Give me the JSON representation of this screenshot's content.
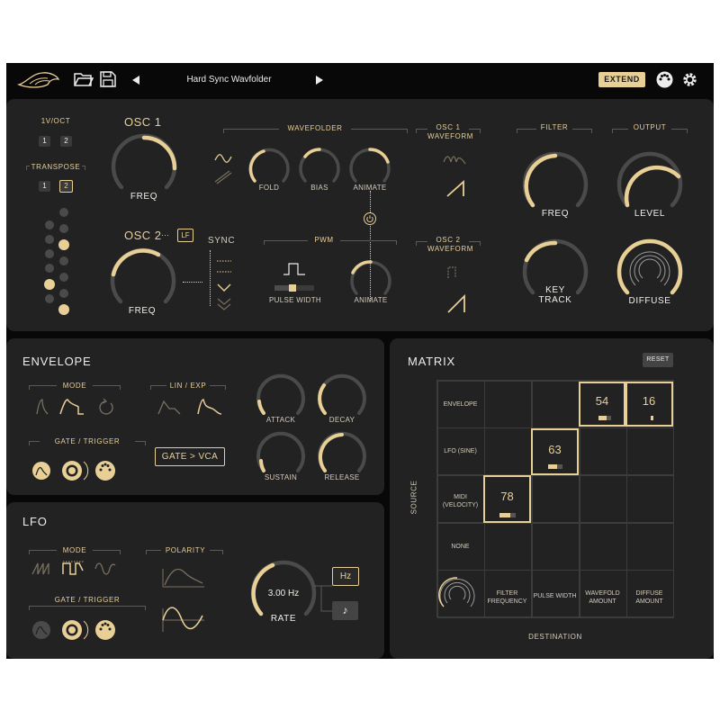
{
  "header": {
    "preset_name": "Hard Sync Wavfolder",
    "extend_label": "EXTEND"
  },
  "osc_section": {
    "vroct_label": "1V/OCT",
    "vroct_buttons": [
      "1",
      "2"
    ],
    "transpose_label": "TRANSPOSE",
    "transpose_buttons": [
      "1",
      "2"
    ],
    "osc1_title": "OSC 1",
    "osc1_freq_label": "FREQ",
    "osc2_title": "OSC 2",
    "osc2_badge": "LF",
    "osc2_freq_label": "FREQ",
    "sync_label": "SYNC",
    "wavefolder_label": "WAVEFOLDER",
    "fold_label": "FOLD",
    "bias_label": "BIAS",
    "wf_animate_label": "ANIMATE",
    "pwm_label": "PWM",
    "pulse_width_label": "PULSE WIDTH",
    "pwm_animate_label": "ANIMATE",
    "osc1_waveform_label_1": "OSC 1",
    "osc1_waveform_label_2": "WAVEFORM",
    "osc2_waveform_label_1": "OSC 2",
    "osc2_waveform_label_2": "WAVEFORM",
    "filter_label": "FILTER",
    "filter_freq_label": "FREQ",
    "key_track_label_1": "KEY",
    "key_track_label_2": "TRACK",
    "output_label": "OUTPUT",
    "level_label": "LEVEL",
    "diffuse_label": "DIFFUSE"
  },
  "envelope": {
    "title": "ENVELOPE",
    "mode_label": "MODE",
    "lin_exp_label": "LIN / EXP",
    "gate_trigger_label": "GATE / TRIGGER",
    "gate_vca_label": "GATE > VCA",
    "attack_label": "ATTACK",
    "decay_label": "DECAY",
    "sustain_label": "SUSTAIN",
    "release_label": "RELEASE"
  },
  "lfo": {
    "title": "LFO",
    "mode_label": "MODE",
    "polarity_label": "POLARITY",
    "gate_trigger_label": "GATE / TRIGGER",
    "rate_value": "3.00 Hz",
    "rate_label": "RATE",
    "hz_label": "Hz",
    "note_icon": "♪"
  },
  "matrix": {
    "title": "MATRIX",
    "reset_label": "RESET",
    "source_axis": "SOURCE",
    "destination_axis": "DESTINATION",
    "rows": [
      {
        "label_1": "ENVELOPE",
        "label_2": ""
      },
      {
        "label_1": "LFO (SINE)",
        "label_2": ""
      },
      {
        "label_1": "MIDI",
        "label_2": "(VELOCITY)"
      },
      {
        "label_1": "NONE",
        "label_2": ""
      }
    ],
    "columns": [
      {
        "label_1": "FILTER",
        "label_2": "FREQUENCY"
      },
      {
        "label_1": "PULSE WIDTH",
        "label_2": ""
      },
      {
        "label_1": "WAVEFOLD",
        "label_2": "AMOUNT"
      },
      {
        "label_1": "DIFFUSE",
        "label_2": "AMOUNT"
      }
    ],
    "cells": [
      {
        "row": 0,
        "col": 2,
        "value": "54"
      },
      {
        "row": 0,
        "col": 3,
        "value": "16"
      },
      {
        "row": 1,
        "col": 1,
        "value": "63"
      },
      {
        "row": 2,
        "col": 0,
        "value": "78"
      }
    ]
  },
  "icons": [
    "shell-logo-icon",
    "folder-icon",
    "save-icon",
    "prev-arrow-icon",
    "next-arrow-icon",
    "midi-icon",
    "gear-icon",
    "power-icon",
    "note-icon"
  ],
  "colors": {
    "accent": "#e8cf96",
    "panel": "#222223",
    "background": "#080808",
    "track": "#4a4a4a"
  }
}
